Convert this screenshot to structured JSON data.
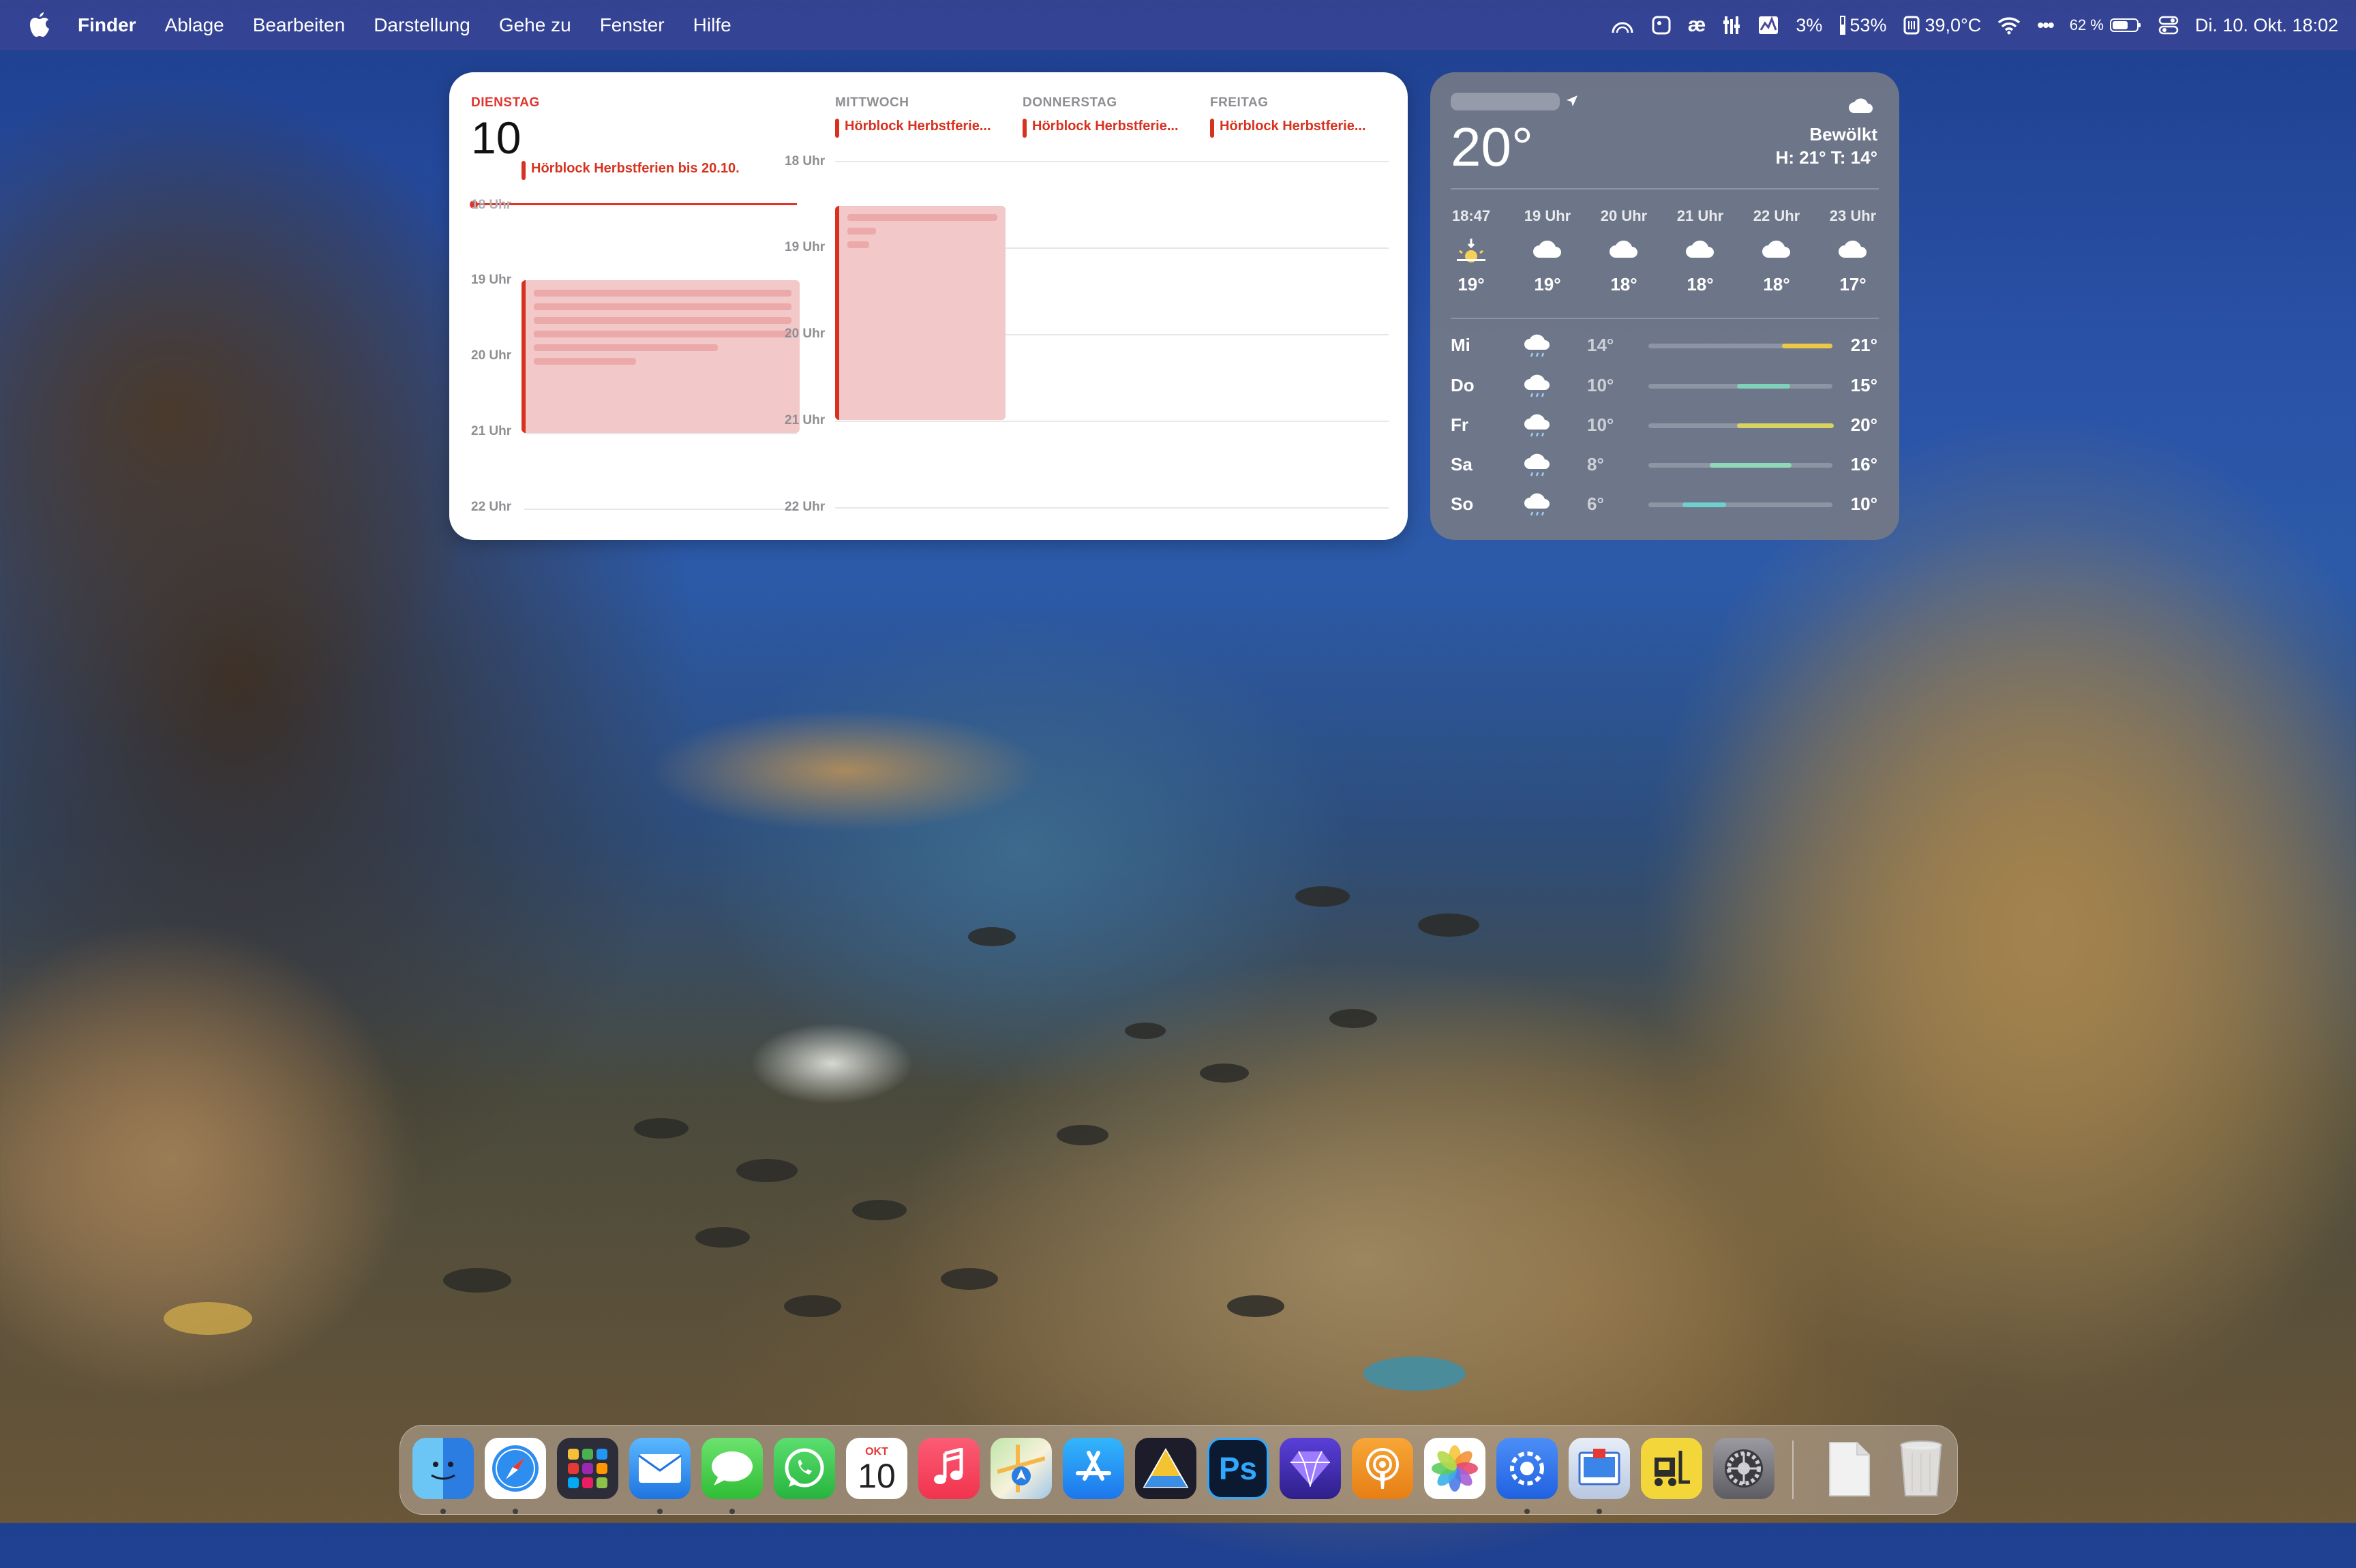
{
  "menubar": {
    "app": "Finder",
    "items": [
      "Ablage",
      "Bearbeiten",
      "Darstellung",
      "Gehe zu",
      "Fenster",
      "Hilfe"
    ],
    "status": {
      "cpu": "3%",
      "memory": "53%",
      "temperature": "39,0°C",
      "battery": "62 %",
      "datetime": "Di. 10. Okt. 18:02"
    }
  },
  "calendar": {
    "today": {
      "dayname": "DIENSTAG",
      "date": "10"
    },
    "days": [
      "MITTWOCH",
      "DONNERSTAG",
      "FREITAG"
    ],
    "allday_today": "Hörblock Herbstferien bis 20.10.",
    "allday_other": "Hörblock Herbstferie...",
    "left_hours": [
      "18 Uhr",
      "19 Uhr",
      "20 Uhr",
      "21 Uhr",
      "22 Uhr"
    ],
    "right_hours": [
      "18 Uhr",
      "19 Uhr",
      "20 Uhr",
      "21 Uhr",
      "22 Uhr"
    ]
  },
  "weather": {
    "temp": "20°",
    "condition": "Bewölkt",
    "highlow": "H: 21° T: 14°",
    "hourly": [
      {
        "time": "18:47",
        "temp": "19°",
        "icon": "sunset-icon"
      },
      {
        "time": "19 Uhr",
        "temp": "19°",
        "icon": "cloud-icon"
      },
      {
        "time": "20 Uhr",
        "temp": "18°",
        "icon": "cloud-icon"
      },
      {
        "time": "21 Uhr",
        "temp": "18°",
        "icon": "cloud-icon"
      },
      {
        "time": "22 Uhr",
        "temp": "18°",
        "icon": "cloud-icon"
      },
      {
        "time": "23 Uhr",
        "temp": "17°",
        "icon": "cloud-icon"
      }
    ],
    "daily": [
      {
        "day": "Mi",
        "low": "14°",
        "high": "21°",
        "icon": "cloud-rain-icon",
        "color": "#e9c84a"
      },
      {
        "day": "Do",
        "low": "10°",
        "high": "15°",
        "icon": "cloud-rain-icon",
        "color": "#7fd1b9"
      },
      {
        "day": "Fr",
        "low": "10°",
        "high": "20°",
        "icon": "cloud-rain-icon",
        "color": "#d8d263"
      },
      {
        "day": "Sa",
        "low": "8°",
        "high": "16°",
        "icon": "cloud-rain-icon",
        "color": "#8fd8b8"
      },
      {
        "day": "So",
        "low": "6°",
        "high": "10°",
        "icon": "cloud-rain-icon",
        "color": "#6fd0d0"
      }
    ]
  },
  "dock": {
    "calendar_month": "OKT",
    "calendar_day": "10",
    "photoshop_label": "Ps",
    "apps": [
      "finder",
      "safari",
      "launchpad",
      "mail",
      "messages",
      "whatsapp",
      "calendar",
      "music",
      "maps",
      "app-store",
      "affinity",
      "photoshop",
      "gem",
      "podcast",
      "photos",
      "settings-app",
      "preview",
      "forklift",
      "system-preferences",
      "documents",
      "trash"
    ]
  }
}
